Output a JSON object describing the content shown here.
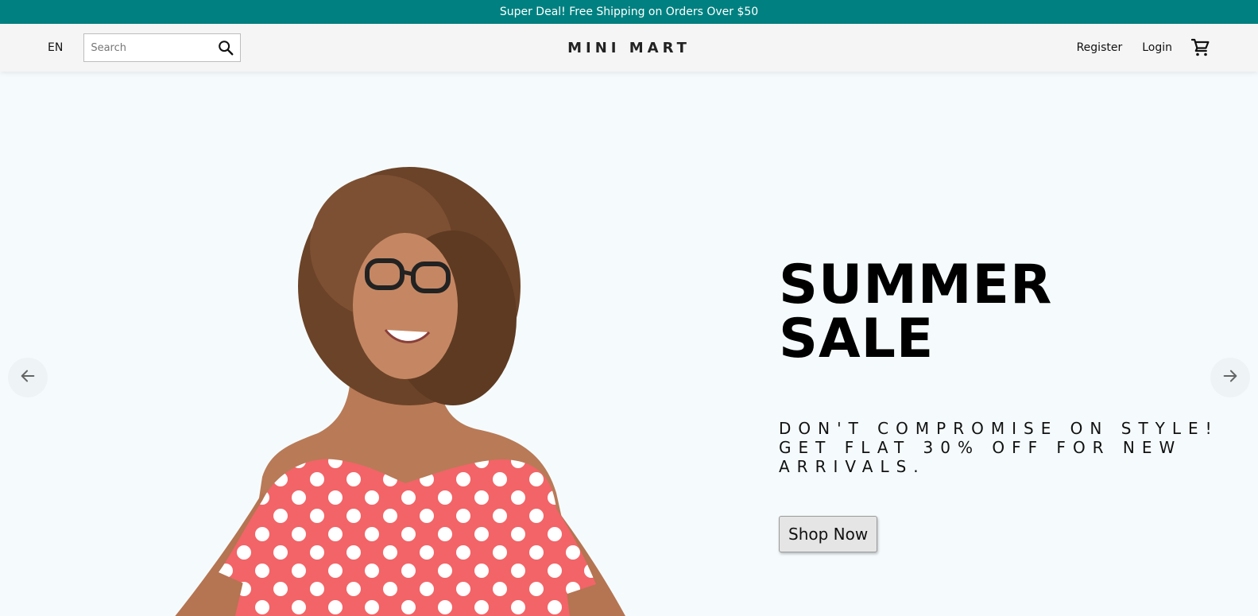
{
  "announcement": {
    "text": "Super Deal! Free Shipping on Orders Over $50"
  },
  "navbar": {
    "language": "EN",
    "search_placeholder": "Search",
    "search_icon": "search-icon",
    "logo": "MINI MART",
    "register": "Register",
    "login": "Login",
    "cart_icon": "cart-icon"
  },
  "slider": {
    "title": "SUMMER SALE",
    "description": "DON'T COMPROMISE ON STYLE! GET FLAT 30% OFF FOR NEW ARRIVALS.",
    "button": "Shop Now",
    "prev_icon": "arrow-left-icon",
    "next_icon": "arrow-right-icon"
  },
  "colors": {
    "announcement_bg": "#008080",
    "navbar_bg": "#f5f5f5",
    "slide_bg": "#f5fbfd",
    "dress_red": "#f26467"
  }
}
